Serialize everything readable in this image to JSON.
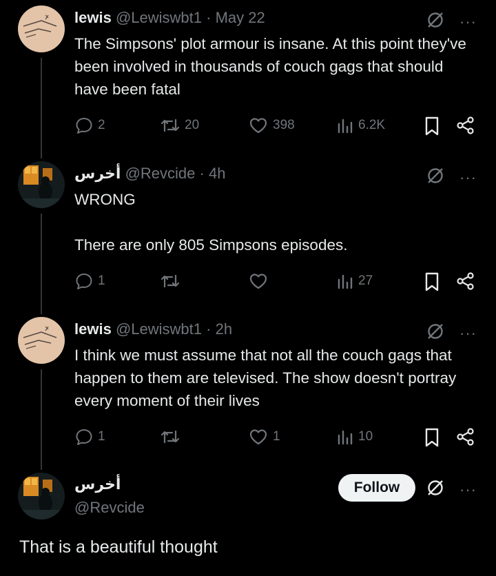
{
  "colors": {
    "background": "#000000",
    "text": "#e7e9ea",
    "muted": "#71767b",
    "follow_bg": "#eff3f4"
  },
  "tweets": [
    {
      "name": "lewis",
      "handle": "@Lewiswbt1",
      "separator": "·",
      "time": "May 22",
      "text": "The Simpsons' plot armour is insane. At this point they've been involved in thousands of couch gags that should have been fatal",
      "replies": "2",
      "reposts": "20",
      "likes": "398",
      "views": "6.2K"
    },
    {
      "name": "أخرس",
      "handle": "@Revcide",
      "separator": "·",
      "time": "4h",
      "text_line1": "WRONG",
      "text_line2": "There are only 805 Simpsons episodes.",
      "replies": "1",
      "reposts": "",
      "likes": "",
      "views": "27"
    },
    {
      "name": "lewis",
      "handle": "@Lewiswbt1",
      "separator": "·",
      "time": "2h",
      "text": "I think we must assume that not all the couch gags that happen to them are televised. The show doesn't portray every moment of their lives",
      "replies": "1",
      "reposts": "",
      "likes": "1",
      "views": "10"
    }
  ],
  "main_post": {
    "name": "أخرس",
    "handle": "@Revcide",
    "follow_label": "Follow",
    "text": "That is a beautiful thought"
  },
  "icons": [
    "grok-icon",
    "more-icon",
    "reply-icon",
    "repost-icon",
    "like-icon",
    "views-icon",
    "bookmark-icon",
    "share-icon"
  ],
  "more_glyph": "···"
}
